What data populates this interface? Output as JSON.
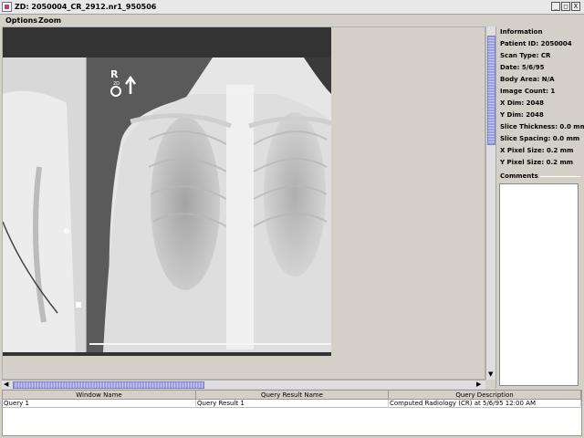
{
  "window": {
    "title": "ZD: 2050004_CR_2912.nr1_950506",
    "buttons": [
      "_",
      "□",
      "X"
    ]
  },
  "menu": [
    "Options",
    "Zoom"
  ],
  "viewer": {
    "image_alt": "chest x-ray",
    "marker": "R",
    "marker_sub": "2D"
  },
  "info": {
    "header": "Information",
    "lines": [
      "Patient ID: 2050004",
      "Scan Type: CR",
      "Date: 5/6/95",
      "Body Area: N/A",
      "Image Count: 1",
      "X Dim: 2048",
      "Y Dim: 2048",
      "Slice Thickness: 0.0 mm",
      "Slice Spacing: 0.0 mm",
      "X Pixel Size: 0.2 mm",
      "Y Pixel Size: 0.2 mm"
    ],
    "comments_label": "Comments"
  },
  "table": {
    "headers": [
      "Window Name",
      "Query Result Name",
      "Query Description"
    ],
    "rows": [
      [
        "Query 1",
        "Query Result 1",
        "Computed Radiology (CR) at 5/6/95 12:00 AM"
      ]
    ]
  },
  "colors": {
    "scroll_thumb": "#9aa0dd",
    "background": "#d4d0c8",
    "image_bg": "#333333"
  }
}
